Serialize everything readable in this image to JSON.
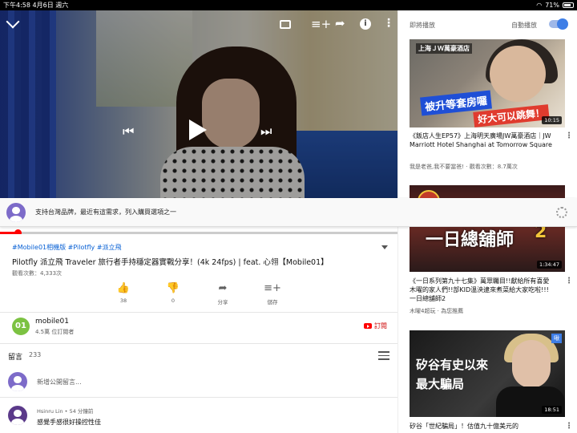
{
  "status_bar": {
    "time": "下午4:58",
    "date": "4月6日 週六",
    "battery": "71%"
  },
  "player": {
    "progress_fraction": 0.045
  },
  "banner": {
    "text": "支持台灣品牌，最近有這需求，列入購買選項之一"
  },
  "video": {
    "tags": [
      "#Mobile01相機版",
      "#Pilotfly",
      "#派立飛"
    ],
    "title": "Pilotfly 派立飛 Traveler 旅行者手持穩定器實戰分享！(4k 24fps) | feat. 心翎【Mobile01】",
    "views": "觀看次數：4,333次",
    "actions": {
      "like_count": "38",
      "dislike_count": "0",
      "share_label": "分享",
      "save_label": "儲存"
    }
  },
  "channel": {
    "logo_text": "01",
    "name": "mobile01",
    "subscribers": "4.5萬 位訂閱者",
    "subscribe_label": "訂閱"
  },
  "comments": {
    "heading": "留言",
    "count": "233",
    "add_placeholder": "新增公開留言...",
    "items": [
      {
        "user_time": "Hsinru Lin • 54 分鐘前",
        "text": "感覺手感很好操控性佳"
      }
    ]
  },
  "sidebar": {
    "up_next_label": "即將播放",
    "autoplay_label": "自動播放",
    "autoplay_on": true,
    "videos": [
      {
        "thumb_top_text": "上海ＪＷ萬豪酒店",
        "thumb_caption_1": "被升等套房囉",
        "thumb_caption_2": "好大可以跳舞！",
        "duration": "10:15",
        "title": "《飯店人生EP57》上海明天廣場JW萬豪酒店｜JW Marriott Hotel Shanghai at Tomorrow Square",
        "channel_views": "我是老爸,我不要當爸! · 觀看次數：8.7萬次"
      },
      {
        "thumb_badge": "一日",
        "thumb_title": "一日總舖師",
        "thumb_num": "2",
        "duration": "1:34:47",
        "title": "《一日系列第九十七集》萬眾矚目!!獻給所有喜愛木曜的家人們!!部KID溫泱逮來煮菜給大家吃啦!!!一日總舖師2",
        "channel_views": "木曜4超玩 · 為您推薦"
      },
      {
        "thumb_tag": "啾",
        "thumb_line_1": "矽谷有史以來",
        "thumb_line_2": "最大騙局",
        "duration": "18:51",
        "title": "矽谷「世紀騙局」！估值九十億美元的",
        "channel_views": ""
      }
    ]
  },
  "colors": {
    "accent_red": "#ff0000",
    "link_blue": "#065fd4",
    "toggle_blue": "#3e7ee6"
  }
}
